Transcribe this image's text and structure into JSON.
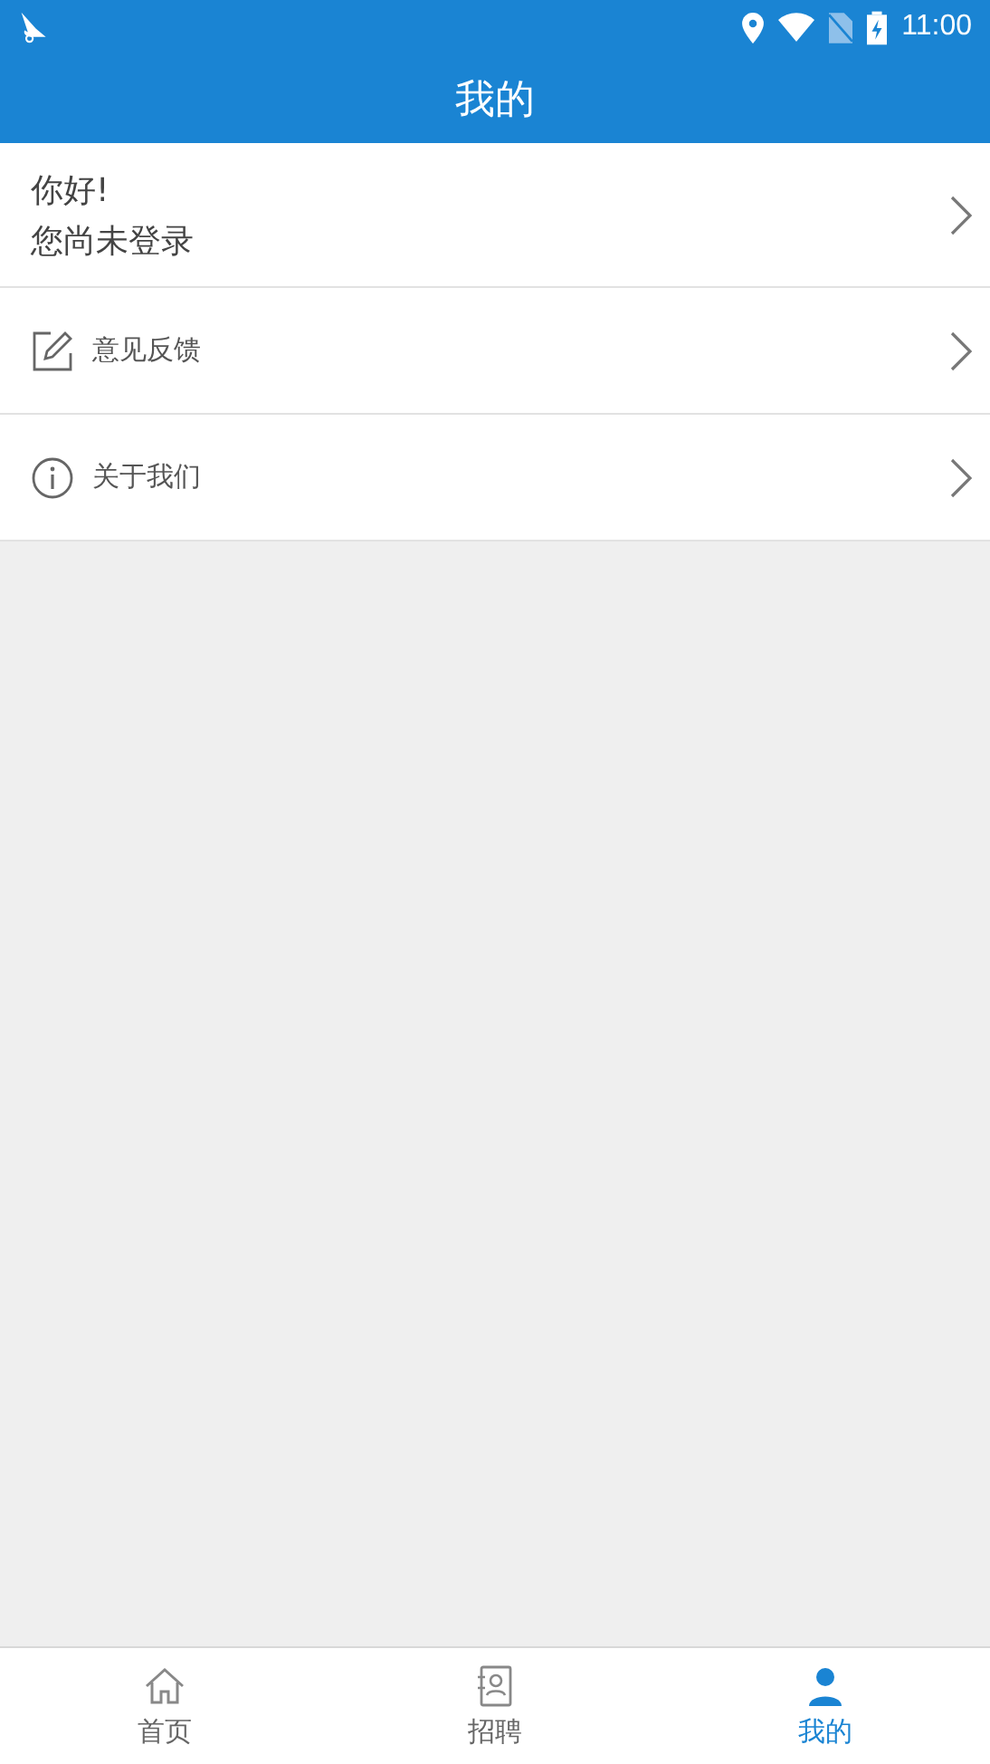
{
  "status_bar": {
    "time": "11:00"
  },
  "header": {
    "title": "我的"
  },
  "profile": {
    "greeting": "你好!",
    "status": "您尚未登录"
  },
  "menu": [
    {
      "kind": "feedback",
      "label": "意见反馈"
    },
    {
      "kind": "about",
      "label": "关于我们"
    }
  ],
  "tabs": [
    {
      "kind": "home",
      "label": "首页",
      "selected": false
    },
    {
      "kind": "jobs",
      "label": "招聘",
      "selected": false
    },
    {
      "kind": "me",
      "label": "我的",
      "selected": true
    }
  ]
}
